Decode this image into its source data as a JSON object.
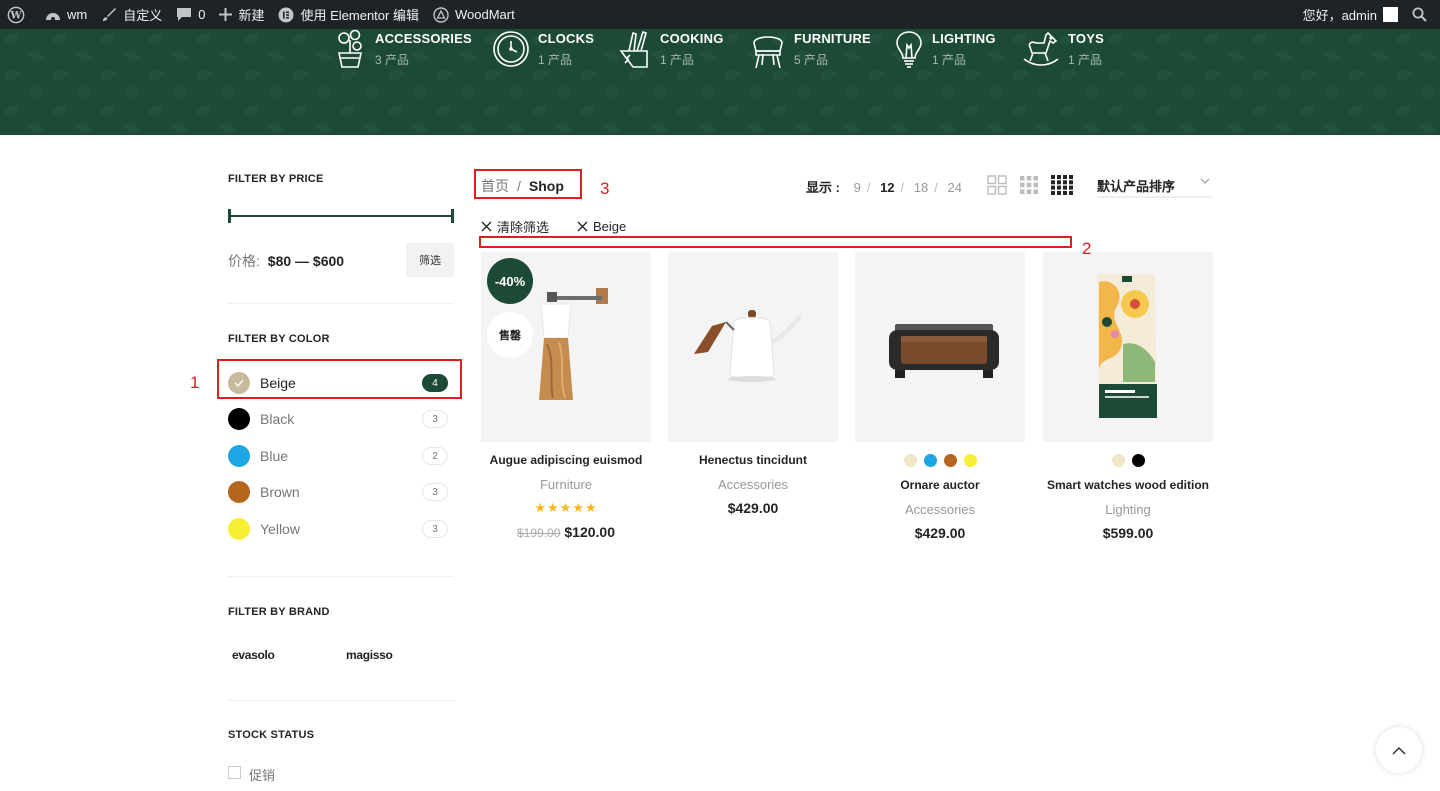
{
  "admin_bar": {
    "site_name": "wm",
    "customize": "自定义",
    "comments_count": "0",
    "new_label": "新建",
    "elementor_label": "使用 Elementor 编辑",
    "woodmart_label": "WoodMart",
    "greeting": "您好，admin"
  },
  "categories": [
    {
      "name": "ACCESSORIES",
      "count": "3 产品",
      "icon": "plant-pot-icon"
    },
    {
      "name": "CLOCKS",
      "count": "1 产品",
      "icon": "clock-icon"
    },
    {
      "name": "COOKING",
      "count": "1 产品",
      "icon": "knife-block-icon"
    },
    {
      "name": "FURNITURE",
      "count": "5 产品",
      "icon": "chair-icon"
    },
    {
      "name": "LIGHTING",
      "count": "1 产品",
      "icon": "lightbulb-icon"
    },
    {
      "name": "TOYS",
      "count": "1 产品",
      "icon": "rocking-horse-icon"
    }
  ],
  "colors": {
    "brand_green": "#1d4a37",
    "annotation_red": "#e01e1e"
  },
  "sidebar": {
    "price_title": "FILTER BY PRICE",
    "price_label": "价格:",
    "price_range": "$80 — $600",
    "price_min": 80,
    "price_max": 600,
    "filter_button": "筛选",
    "color_title": "FILTER BY COLOR",
    "color_items": [
      {
        "label": "Beige",
        "count": "4",
        "hex": "#c8bb9b",
        "active": true
      },
      {
        "label": "Black",
        "count": "3",
        "hex": "#000000",
        "active": false
      },
      {
        "label": "Blue",
        "count": "2",
        "hex": "#1ea5e3",
        "active": false
      },
      {
        "label": "Brown",
        "count": "3",
        "hex": "#b5651d",
        "active": false
      },
      {
        "label": "Yellow",
        "count": "3",
        "hex": "#f7ef35",
        "active": false
      }
    ],
    "brand_title": "FILTER BY BRAND",
    "brands": [
      "evasolo",
      "magisso"
    ],
    "stock_title": "STOCK STATUS",
    "stock_option": "促销"
  },
  "annotations": [
    "1",
    "2",
    "3"
  ],
  "toolbar": {
    "breadcrumb_home": "首页",
    "breadcrumb_sep": "/",
    "breadcrumb_current": "Shop",
    "perpage_label": "显示 :",
    "perpage_options": [
      "9",
      "12",
      "18",
      "24"
    ],
    "perpage_current": "12",
    "perpage_sep": "/",
    "sort_label": "默认产品排序"
  },
  "active_filters": {
    "clear_label": "清除筛选",
    "beige_label": "Beige"
  },
  "products": [
    {
      "title": "Augue adipiscing euismod",
      "category": "Furniture",
      "rating": 5,
      "old_price": "$199.00",
      "price": "$120.00",
      "sale_badge": "-40%",
      "hot_badge": "售罄",
      "swatches": []
    },
    {
      "title": "Henectus tincidunt",
      "category": "Accessories",
      "price": "$429.00",
      "swatches": []
    },
    {
      "title": "Ornare auctor",
      "category": "Accessories",
      "price": "$429.00",
      "swatches": [
        "#f0e6c8",
        "#1ea5e3",
        "#b5651d",
        "#f7ef35"
      ]
    },
    {
      "title": "Smart watches wood edition",
      "category": "Lighting",
      "price": "$599.00",
      "swatches": [
        "#f0e6c8",
        "#000000"
      ]
    }
  ]
}
